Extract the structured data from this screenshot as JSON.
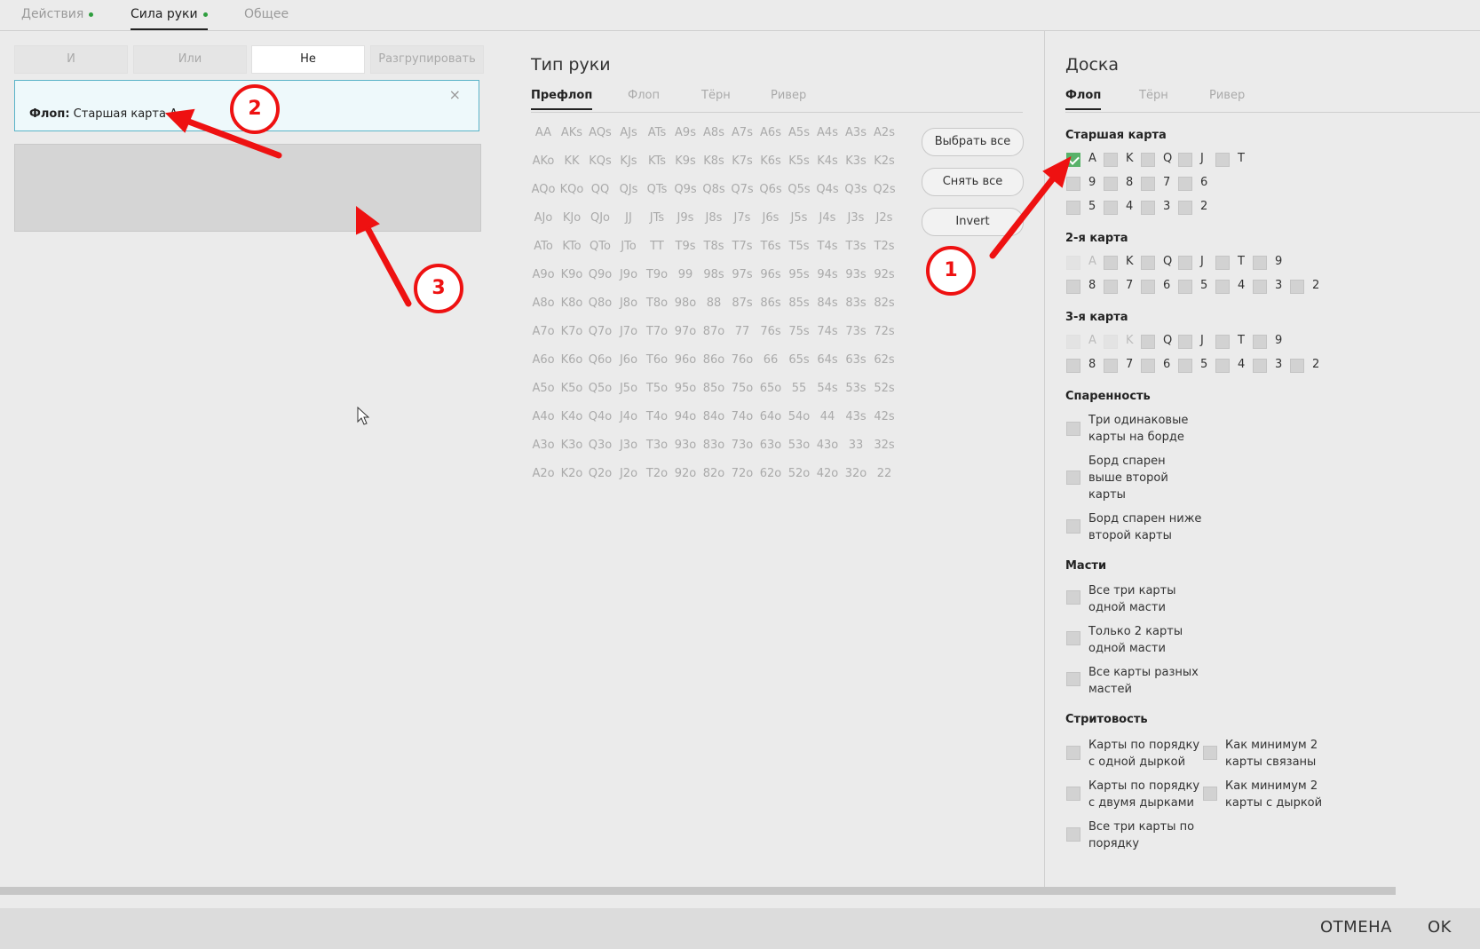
{
  "top_tabs": [
    {
      "label": "Действия",
      "dot": true
    },
    {
      "label": "Сила руки",
      "dot": true
    },
    {
      "label": "Общее",
      "dot": false
    }
  ],
  "logic_buttons": [
    "И",
    "Или",
    "Не",
    "Разгрупировать"
  ],
  "filter": {
    "prefix": "Флоп:",
    "value": "Старшая карта А",
    "close": "×"
  },
  "hand_type": {
    "title": "Тип руки",
    "tabs": [
      "Префлоп",
      "Флоп",
      "Тёрн",
      "Ривер"
    ],
    "grid": [
      [
        "AA",
        "AKs",
        "AQs",
        "AJs",
        "ATs",
        "A9s",
        "A8s",
        "A7s",
        "A6s",
        "A5s",
        "A4s",
        "A3s",
        "A2s"
      ],
      [
        "AKo",
        "KK",
        "KQs",
        "KJs",
        "KTs",
        "K9s",
        "K8s",
        "K7s",
        "K6s",
        "K5s",
        "K4s",
        "K3s",
        "K2s"
      ],
      [
        "AQo",
        "KQo",
        "QQ",
        "QJs",
        "QTs",
        "Q9s",
        "Q8s",
        "Q7s",
        "Q6s",
        "Q5s",
        "Q4s",
        "Q3s",
        "Q2s"
      ],
      [
        "AJo",
        "KJo",
        "QJo",
        "JJ",
        "JTs",
        "J9s",
        "J8s",
        "J7s",
        "J6s",
        "J5s",
        "J4s",
        "J3s",
        "J2s"
      ],
      [
        "ATo",
        "KTo",
        "QTo",
        "JTo",
        "TT",
        "T9s",
        "T8s",
        "T7s",
        "T6s",
        "T5s",
        "T4s",
        "T3s",
        "T2s"
      ],
      [
        "A9o",
        "K9o",
        "Q9o",
        "J9o",
        "T9o",
        "99",
        "98s",
        "97s",
        "96s",
        "95s",
        "94s",
        "93s",
        "92s"
      ],
      [
        "A8o",
        "K8o",
        "Q8o",
        "J8o",
        "T8o",
        "98o",
        "88",
        "87s",
        "86s",
        "85s",
        "84s",
        "83s",
        "82s"
      ],
      [
        "A7o",
        "K7o",
        "Q7o",
        "J7o",
        "T7o",
        "97o",
        "87o",
        "77",
        "76s",
        "75s",
        "74s",
        "73s",
        "72s"
      ],
      [
        "A6o",
        "K6o",
        "Q6o",
        "J6o",
        "T6o",
        "96o",
        "86o",
        "76o",
        "66",
        "65s",
        "64s",
        "63s",
        "62s"
      ],
      [
        "A5o",
        "K5o",
        "Q5o",
        "J5o",
        "T5o",
        "95o",
        "85o",
        "75o",
        "65o",
        "55",
        "54s",
        "53s",
        "52s"
      ],
      [
        "A4o",
        "K4o",
        "Q4o",
        "J4o",
        "T4o",
        "94o",
        "84o",
        "74o",
        "64o",
        "54o",
        "44",
        "43s",
        "42s"
      ],
      [
        "A3o",
        "K3o",
        "Q3o",
        "J3o",
        "T3o",
        "93o",
        "83o",
        "73o",
        "63o",
        "53o",
        "43o",
        "33",
        "32s"
      ],
      [
        "A2o",
        "K2o",
        "Q2o",
        "J2o",
        "T2o",
        "92o",
        "82o",
        "72o",
        "62o",
        "52o",
        "42o",
        "32o",
        "22"
      ]
    ],
    "buttons": [
      "Выбрать все",
      "Снять все",
      "Invert"
    ]
  },
  "board": {
    "title": "Доска",
    "tabs": [
      "Флоп",
      "Тёрн",
      "Ривер"
    ],
    "high_card": {
      "title": "Старшая карта",
      "rows": [
        [
          {
            "l": "A",
            "s": "checked"
          },
          {
            "l": "K",
            "s": ""
          },
          {
            "l": "Q",
            "s": ""
          },
          {
            "l": "J",
            "s": ""
          },
          {
            "l": "T",
            "s": ""
          }
        ],
        [
          {
            "l": "9",
            "s": ""
          },
          {
            "l": "8",
            "s": ""
          },
          {
            "l": "7",
            "s": ""
          },
          {
            "l": "6",
            "s": ""
          }
        ],
        [
          {
            "l": "5",
            "s": ""
          },
          {
            "l": "4",
            "s": ""
          },
          {
            "l": "3",
            "s": ""
          },
          {
            "l": "2",
            "s": ""
          }
        ]
      ]
    },
    "second_card": {
      "title": "2-я карта",
      "rows": [
        [
          {
            "l": "A",
            "s": "disabled"
          },
          {
            "l": "K",
            "s": ""
          },
          {
            "l": "Q",
            "s": ""
          },
          {
            "l": "J",
            "s": ""
          },
          {
            "l": "T",
            "s": ""
          },
          {
            "l": "9",
            "s": ""
          }
        ],
        [
          {
            "l": "8",
            "s": ""
          },
          {
            "l": "7",
            "s": ""
          },
          {
            "l": "6",
            "s": ""
          },
          {
            "l": "5",
            "s": ""
          },
          {
            "l": "4",
            "s": ""
          },
          {
            "l": "3",
            "s": ""
          },
          {
            "l": "2",
            "s": ""
          }
        ]
      ]
    },
    "third_card": {
      "title": "3-я карта",
      "rows": [
        [
          {
            "l": "A",
            "s": "disabled"
          },
          {
            "l": "K",
            "s": "disabled"
          },
          {
            "l": "Q",
            "s": ""
          },
          {
            "l": "J",
            "s": ""
          },
          {
            "l": "T",
            "s": ""
          },
          {
            "l": "9",
            "s": ""
          }
        ],
        [
          {
            "l": "8",
            "s": ""
          },
          {
            "l": "7",
            "s": ""
          },
          {
            "l": "6",
            "s": ""
          },
          {
            "l": "5",
            "s": ""
          },
          {
            "l": "4",
            "s": ""
          },
          {
            "l": "3",
            "s": ""
          },
          {
            "l": "2",
            "s": ""
          }
        ]
      ]
    },
    "pairing": {
      "title": "Спаренность",
      "options": [
        "Три одинаковые карты на борде",
        "Борд спарен выше второй карты",
        "Борд спарен ниже второй карты"
      ]
    },
    "suits": {
      "title": "Масти",
      "options": [
        "Все три карты одной масти",
        "Только 2 карты одной масти",
        "Все карты разных мастей"
      ]
    },
    "straightness": {
      "title": "Стритовость",
      "left": [
        "Карты по порядку с одной дыркой",
        "Карты по порядку с двумя дырками",
        "Все три карты по порядку"
      ],
      "right": [
        "Как минимум 2 карты связаны",
        "Как минимум 2 карты с дыркой"
      ]
    }
  },
  "footer": {
    "cancel": "ОТМЕНА",
    "ok": "OK"
  },
  "annotations": [
    "1",
    "2",
    "3"
  ],
  "colors": {
    "accent_green": "#59b26a",
    "filter_border": "#5ab4c8",
    "annotation_red": "#ee1111"
  }
}
